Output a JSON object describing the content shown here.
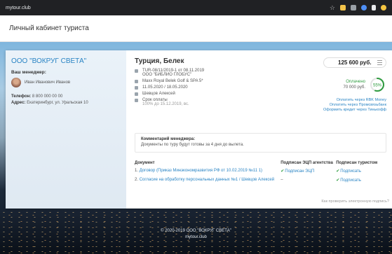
{
  "browser": {
    "url": "mytour.club"
  },
  "header": {
    "title": "Личный кабинет туриста"
  },
  "agency": {
    "name": "ООО \"ВОКРУГ СВЕТА\"",
    "manager_label": "Ваш менеджер:",
    "manager_name": "Иван Иванович Иванов",
    "phone_label": "Телефон:",
    "phone": "8 800 000 00 00",
    "address_label": "Адрес:",
    "address": "Екатеринбург, ул. Уральская 10"
  },
  "trip": {
    "title": "Турция, Белек",
    "rows": [
      {
        "text": "TUR-08/11/2019-1 от 08.11.2019",
        "sub": "ООО \"БИБЛИО ГЛОБУС\""
      },
      {
        "text": "Maxx Royal Belek Golf & SPA 5*",
        "sub": ""
      },
      {
        "text": "11.05.2020 / 18.05.2020",
        "sub": ""
      },
      {
        "text": "Шевцов Алексей",
        "sub": ""
      },
      {
        "text": "Срок оплаты",
        "sub": "100% до 15.12.2019, вс."
      }
    ]
  },
  "price": {
    "amount": "125 600 руб."
  },
  "payment": {
    "status": "Оплачено",
    "paid_amount": "70 000 руб.",
    "percent_label": "55%",
    "percent": 0.55,
    "links": [
      "Оплатить через RBK Money",
      "Оплатить через Промсвязьбанк",
      "Оформить кредит через Тинькофф"
    ]
  },
  "comment": {
    "heading": "Комментарий менеджера:",
    "text": "Документы по туру будут готовы за 4 дня до вылета."
  },
  "documents": {
    "headers": [
      "Документ",
      "Подписан ЭЦП агентства",
      "Подписан туристом"
    ],
    "rows": [
      {
        "num": "1.",
        "name": "Договор (Приказ Минэкономразвития РФ от 10.02.2019 №11 1)",
        "agency": "Подписан ЭЦП",
        "tourist": "Подписать"
      },
      {
        "num": "2.",
        "name": "Согласие на обработку персональных данных №1 / Шевцов Алексей",
        "agency": "–",
        "tourist": "Подписать"
      }
    ],
    "verify_link": "Как проверить электронную подпись?"
  },
  "footer": {
    "line1": "© 2020-2019 ООО \"ВОКРУГ СВЕТА\"",
    "line2": "mytour.club"
  },
  "colors": {
    "accent": "#2a84c4",
    "success": "#2e9b3f"
  }
}
